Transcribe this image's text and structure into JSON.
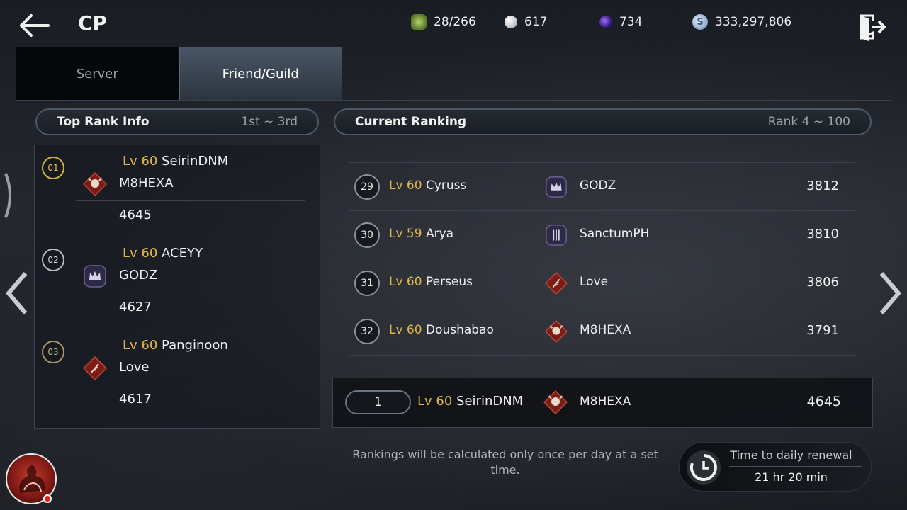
{
  "header": {
    "title": "CP",
    "currencies": [
      {
        "icon": "energy-gem-icon",
        "value": "28/266"
      },
      {
        "icon": "pearl-icon",
        "value": "617"
      },
      {
        "icon": "dark-crystal-icon",
        "value": "734"
      },
      {
        "icon": "silver-coin-icon",
        "value": "333,297,806"
      }
    ]
  },
  "tabs": [
    {
      "label": "Server",
      "active": false
    },
    {
      "label": "Friend/Guild",
      "active": true
    }
  ],
  "top_rank": {
    "title": "Top Rank Info",
    "range": "1st ~ 3rd",
    "entries": [
      {
        "badge": "01",
        "level": "Lv 60",
        "name": "SeirinDNM",
        "guild": "M8HEXA",
        "score": "4645"
      },
      {
        "badge": "02",
        "level": "Lv 60",
        "name": "ACEYY",
        "guild": "GODZ",
        "score": "4627"
      },
      {
        "badge": "03",
        "level": "Lv 60",
        "name": "Panginoon",
        "guild": "Love",
        "score": "4617"
      }
    ]
  },
  "current_ranking": {
    "title": "Current Ranking",
    "range": "Rank 4 ~ 100",
    "rows": [
      {
        "rank": "29",
        "level": "Lv 60",
        "name": "Cyruss",
        "guild": "GODZ",
        "score": "3812"
      },
      {
        "rank": "30",
        "level": "Lv 59",
        "name": "Arya",
        "guild": "SanctumPH",
        "score": "3810"
      },
      {
        "rank": "31",
        "level": "Lv 60",
        "name": "Perseus",
        "guild": "Love",
        "score": "3806"
      },
      {
        "rank": "32",
        "level": "Lv 60",
        "name": "Doushabao",
        "guild": "M8HEXA",
        "score": "3791"
      }
    ]
  },
  "my_rank": {
    "rank": "1",
    "level": "Lv 60",
    "name": "SeirinDNM",
    "guild": "M8HEXA",
    "score": "4645"
  },
  "footer": {
    "notice": "Rankings will be calculated only once per day at a set time.",
    "renewal_label": "Time to daily renewal",
    "renewal_time": "21 hr 20 min"
  },
  "colors": {
    "level": "#e0b84a",
    "gold_badge": "#d4b23c",
    "guild_red": "#8a1f1a",
    "guild_purple": "#3b3552"
  }
}
